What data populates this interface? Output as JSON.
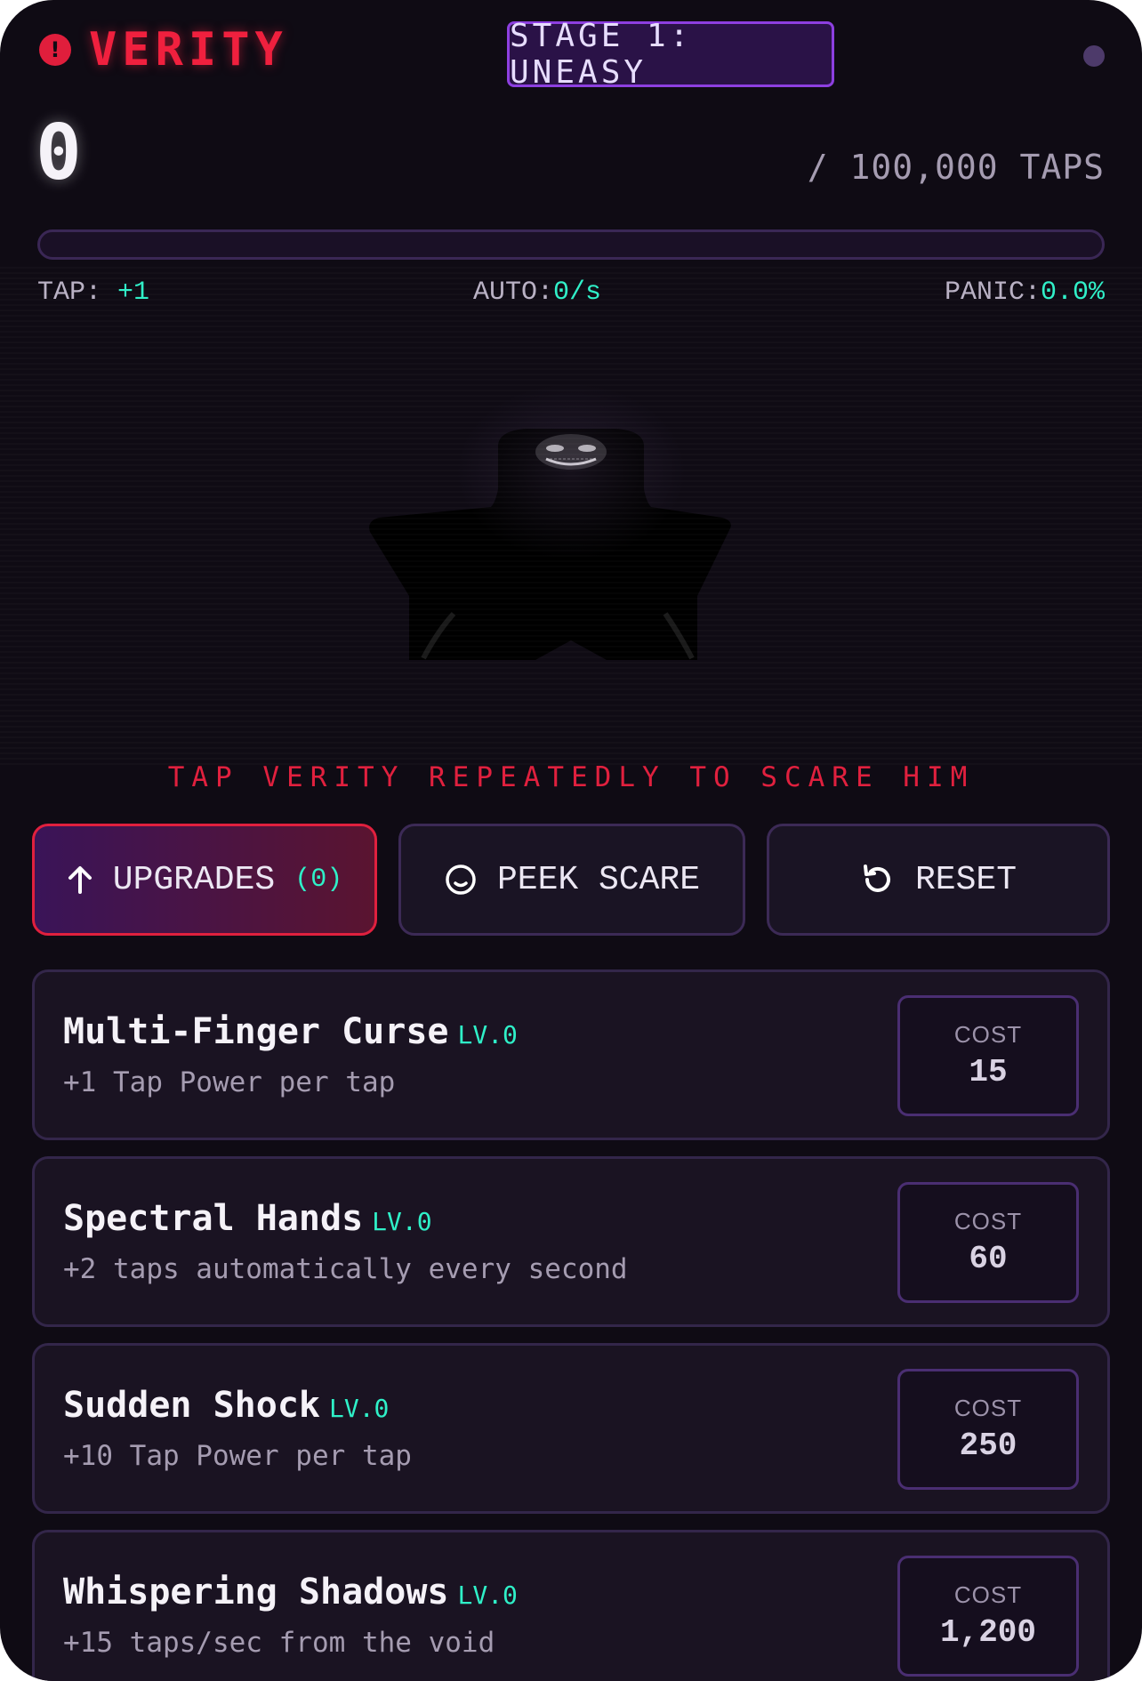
{
  "header": {
    "brand_icon": "!",
    "title": "VERITY",
    "stage": "STAGE 1: UNEASY"
  },
  "score": {
    "current": "0",
    "goal": "/ 100,000 TAPS",
    "progress_fraction": 0
  },
  "stats": {
    "tap_label": "TAP:",
    "tap_value": "+1",
    "auto_label": "AUTO:",
    "auto_value": "0/s",
    "panic_label": "PANIC:",
    "panic_value": "0.0%"
  },
  "hint": "TAP VERITY REPEATEDLY TO SCARE HIM",
  "actions": {
    "upgrades_label": "UPGRADES",
    "upgrades_count": "(0)",
    "peek_label": "PEEK SCARE",
    "reset_label": "RESET"
  },
  "upgrades": [
    {
      "name": "Multi-Finger Curse",
      "level": "LV.0",
      "desc": "+1 Tap Power per tap",
      "cost_label": "COST",
      "cost": "15"
    },
    {
      "name": "Spectral Hands",
      "level": "LV.0",
      "desc": "+2 taps automatically every second",
      "cost_label": "COST",
      "cost": "60"
    },
    {
      "name": "Sudden Shock",
      "level": "LV.0",
      "desc": "+10 Tap Power per tap",
      "cost_label": "COST",
      "cost": "250"
    },
    {
      "name": "Whispering Shadows",
      "level": "LV.0",
      "desc": "+15 taps/sec from the void",
      "cost_label": "COST",
      "cost": "1,200"
    }
  ],
  "colors": {
    "accent_red": "#e0203e",
    "accent_purple": "#8d3fe0",
    "accent_cyan": "#2ff0c8",
    "background": "#0f0b14"
  },
  "icons": {
    "brand": "alert-circle-icon",
    "upgrades": "arrow-up-icon",
    "peek": "smile-face-icon",
    "reset": "rotate-ccw-icon"
  }
}
